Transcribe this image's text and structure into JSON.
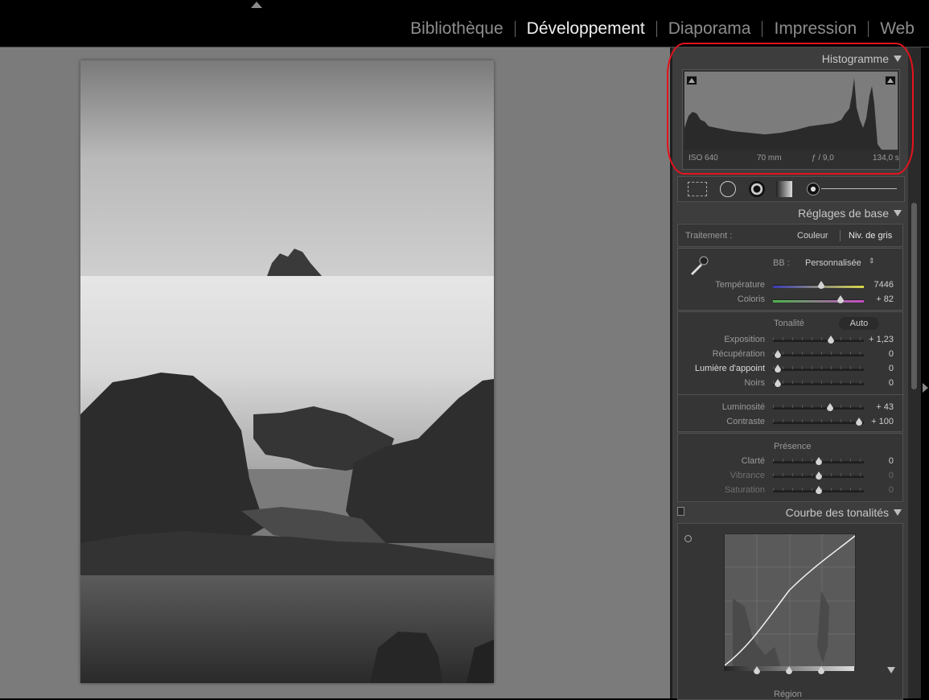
{
  "modules": [
    "Bibliothèque",
    "Développement",
    "Diaporama",
    "Impression",
    "Web"
  ],
  "active_module": "Développement",
  "histogram": {
    "title": "Histogramme",
    "iso": "ISO 640",
    "focal": "70 mm",
    "aperture": "ƒ / 9,0",
    "shutter": "134,0 s"
  },
  "basic": {
    "title": "Réglages de base",
    "treatment_label": "Traitement :",
    "color_option": "Couleur",
    "bw_option": "Niv. de gris",
    "wb_label": "BB :",
    "wb_value": "Personnalisée",
    "temperature": {
      "label": "Température",
      "value": "7446",
      "pos": 0.53
    },
    "tint": {
      "label": "Coloris",
      "value": "+ 82",
      "pos": 0.74
    },
    "tone_label": "Tonalité",
    "auto_label": "Auto",
    "exposure": {
      "label": "Exposition",
      "value": "+ 1,23",
      "pos": 0.63
    },
    "recovery": {
      "label": "Récupération",
      "value": "0",
      "pos": 0.0
    },
    "fill_light": {
      "label": "Lumière d'appoint",
      "value": "0",
      "pos": 0.0
    },
    "blacks": {
      "label": "Noirs",
      "value": "0",
      "pos": 0.0
    },
    "brightness": {
      "label": "Luminosité",
      "value": "+ 43",
      "pos": 0.62
    },
    "contrast": {
      "label": "Contraste",
      "value": "+ 100",
      "pos": 0.95
    },
    "presence_label": "Présence",
    "clarity": {
      "label": "Clarté",
      "value": "0",
      "pos": 0.5
    },
    "vibrance": {
      "label": "Vibrance",
      "value": "0",
      "pos": 0.5
    },
    "saturation": {
      "label": "Saturation",
      "value": "0",
      "pos": 0.5
    }
  },
  "tone_curve": {
    "title": "Courbe des tonalités",
    "region_label": "Région"
  }
}
